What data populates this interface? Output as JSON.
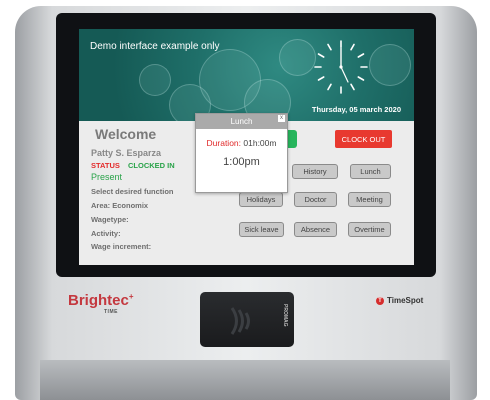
{
  "banner": {
    "notice": "Demo interface example only",
    "date": "Thursday, 05 march 2020"
  },
  "panel": {
    "welcome": "Welcome",
    "employee_name": "Patty S. Esparza",
    "status_label": "STATUS",
    "status_value": "CLOCKED IN",
    "presence": "Present",
    "prompt": "Select desired function",
    "area": "Area: Economix",
    "wagetype": "Wagetype:",
    "activity": "Activity:",
    "wage_increment": "Wage increment:"
  },
  "buttons": {
    "clock_out": "CLOCK OUT",
    "history": "History",
    "lunch": "Lunch",
    "holidays": "Holidays",
    "doctor": "Doctor",
    "meeting": "Meeting",
    "sick_leave": "Sick leave",
    "absence": "Absence",
    "overtime": "Overtime"
  },
  "popup": {
    "title": "Lunch",
    "close_glyph": "x",
    "duration_label": "Duration:",
    "duration_value": "01h:00m",
    "time": "1:00pm"
  },
  "device": {
    "brand": "Brightec",
    "brand_sub": "TIME",
    "partner": "TimeSpot",
    "reader_label": "PROMAG"
  },
  "colors": {
    "clock_out": "#e8392f",
    "status_label": "#e32b2b",
    "status_value": "#2aa34a",
    "banner": "#1f6f69"
  }
}
